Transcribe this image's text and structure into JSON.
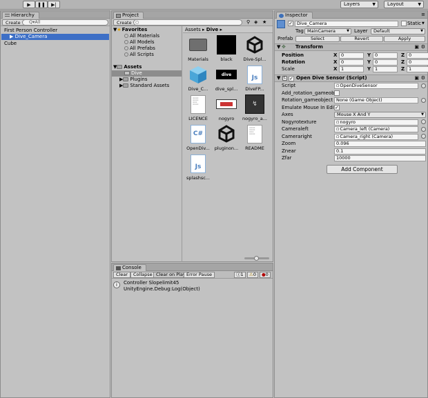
{
  "toolbar": {
    "play_icon": "play-icon",
    "pause_icon": "pause-icon",
    "step_icon": "step-icon",
    "layers_label": "Layers",
    "layout_label": "Layout"
  },
  "hierarchy": {
    "tab": "Hierarchy",
    "create": "Create",
    "search_placeholder": "Q▾All",
    "items": [
      {
        "label": "First Person Controller"
      },
      {
        "label": "Dive_Camera"
      },
      {
        "label": "Cube"
      }
    ]
  },
  "project": {
    "tab": "Project",
    "create": "Create",
    "favorites": {
      "label": "Favorites",
      "items": [
        "All Materials",
        "All Models",
        "All Prefabs",
        "All Scripts"
      ]
    },
    "assets": {
      "label": "Assets",
      "items": [
        "Dive",
        "Plugins",
        "Standard Assets"
      ]
    },
    "breadcrumb": {
      "root": "Assets",
      "sep": "▸",
      "current": "Dive",
      "end": "▸"
    },
    "grid": [
      {
        "label": "Materials",
        "kind": "folder"
      },
      {
        "label": "black",
        "kind": "black"
      },
      {
        "label": "Dive-Spl...",
        "kind": "unity"
      },
      {
        "label": "Dive_C...",
        "kind": "cube"
      },
      {
        "label": "dive_spl...",
        "kind": "dive"
      },
      {
        "label": "DiveFP...",
        "kind": "js"
      },
      {
        "label": "LICENCE",
        "kind": "doc"
      },
      {
        "label": "nogyro",
        "kind": "nogyro"
      },
      {
        "label": "nogyro_a...",
        "kind": "nogyroa"
      },
      {
        "label": "OpenDiv...",
        "kind": "cs"
      },
      {
        "label": "pluginon...",
        "kind": "unity"
      },
      {
        "label": "README",
        "kind": "doc"
      },
      {
        "label": "splashsc...",
        "kind": "js"
      }
    ]
  },
  "console": {
    "tab": "Console",
    "buttons": [
      "Clear",
      "Collapse",
      "Clear on Play",
      "Error Pause"
    ],
    "counts": {
      "info": "1",
      "warn": "0",
      "error": "0"
    },
    "message_line1": "Controller Slopelimit45",
    "message_line2": "UnityEngine.Debug:Log(Object)"
  },
  "inspector": {
    "tab": "Inspector",
    "object_name": "Dive_Camera",
    "static_label": "Static",
    "tag_label": "Tag",
    "tag_value": "MainCamera",
    "layer_label": "Layer",
    "layer_value": "Default",
    "prefab_label": "Prefab",
    "prefab_buttons": [
      "Select",
      "Revert",
      "Apply"
    ],
    "transform": {
      "title": "Transform",
      "rows": [
        {
          "label": "Position",
          "x": "0",
          "y": "0",
          "z": "0"
        },
        {
          "label": "Rotation",
          "x": "0",
          "y": "0",
          "z": "0"
        },
        {
          "label": "Scale",
          "x": "1",
          "y": "1",
          "z": "1"
        }
      ]
    },
    "script_comp": {
      "title": "Open Dive Sensor (Script)",
      "rows": [
        {
          "label": "Script",
          "value": "OpenDiveSensor",
          "type": "ref"
        },
        {
          "label": "Add_rotation_gameobj",
          "value": "",
          "type": "check"
        },
        {
          "label": "Rotation_gameobject",
          "value": "None (Game Object)",
          "type": "ref"
        },
        {
          "label": "Emulate Mouse In Edit",
          "value": "✓",
          "type": "check"
        },
        {
          "label": "Axes",
          "value": "Mouse X And Y",
          "type": "dropdown"
        },
        {
          "label": "Nogyrotexture",
          "value": "nogyro",
          "type": "ref"
        },
        {
          "label": "Cameraleft",
          "value": "Camera_left (Camera)",
          "type": "ref"
        },
        {
          "label": "Cameraright",
          "value": "Camera_right (Camera)",
          "type": "ref"
        },
        {
          "label": "Zoom",
          "value": "0.096",
          "type": "text"
        },
        {
          "label": "Znear",
          "value": "0.1",
          "type": "text"
        },
        {
          "label": "Zfar",
          "value": "10000",
          "type": "text"
        }
      ]
    },
    "add_component": "Add Component"
  }
}
